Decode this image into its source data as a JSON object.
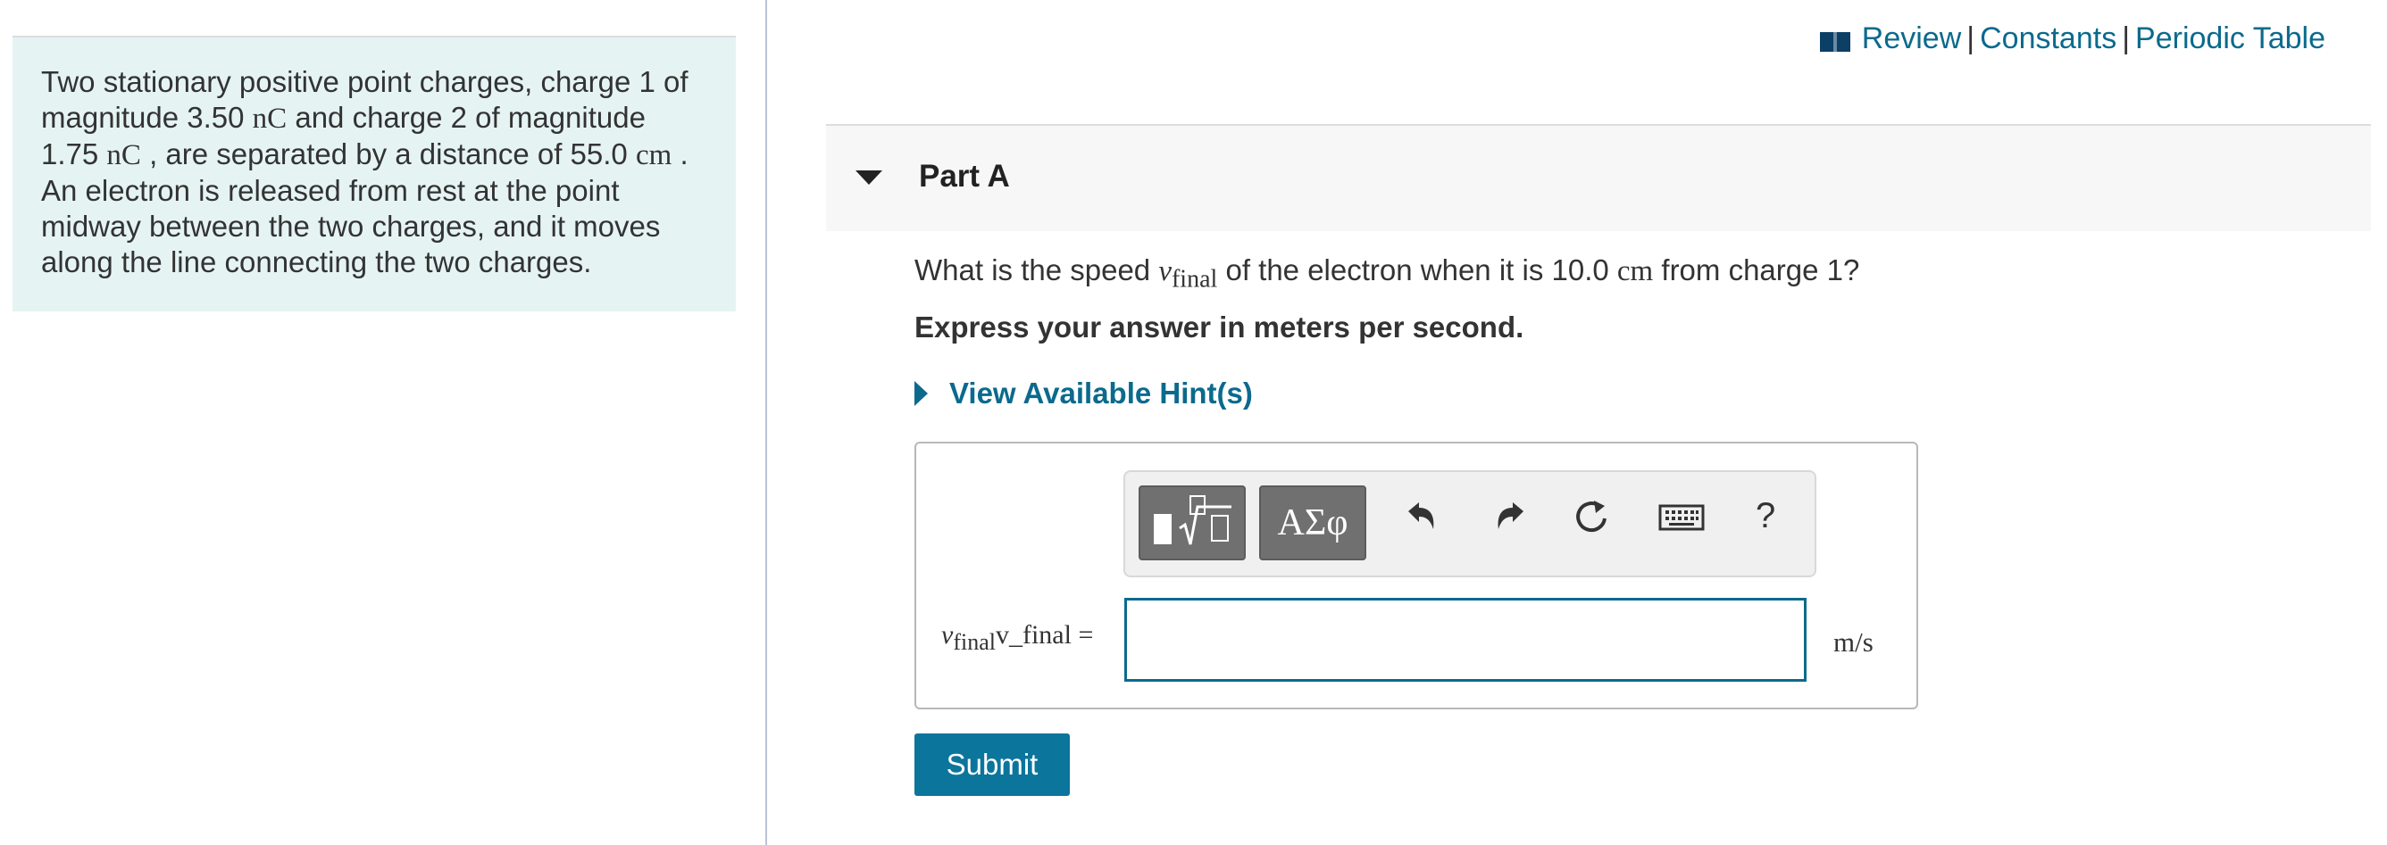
{
  "problem": {
    "line1": "Two stationary positive point charges, charge 1 of",
    "line2_a": "magnitude 3.50 ",
    "line2_unit": "nC",
    "line2_b": " and charge 2 of magnitude",
    "line3_a": "1.75 ",
    "line3_unit": "nC",
    "line3_b": " , are separated by a distance of 55.0 ",
    "line3_unit2": "cm",
    "line3_c": " .",
    "line4": "An electron is released from rest at the point",
    "line5": "midway between the two charges, and it moves",
    "line6": "along the line connecting the two charges."
  },
  "header_links": {
    "review": "Review",
    "separator": "|",
    "constants": "Constants",
    "periodic_table": "Periodic Table"
  },
  "part": {
    "title": "Part A",
    "question_a": "What is the speed ",
    "question_var": "v",
    "question_sub": "final",
    "question_b": " of the electron when it is 10.0 ",
    "question_unit": "cm",
    "question_c": " from charge 1?",
    "instruction": "Express your answer in meters per second.",
    "hint_label": "View Available Hint(s)"
  },
  "answer": {
    "var_symbol": "v",
    "var_sub": "final",
    "var_alt": "v_final =",
    "input_value": "",
    "units": "m/s",
    "toolbar": {
      "templates_icon": "fraction-root-template-icon",
      "greek_label": "ΑΣφ",
      "undo_icon": "undo-icon",
      "redo_icon": "redo-icon",
      "reset_icon": "reset-icon",
      "keyboard_icon": "keyboard-icon",
      "help_label": "?"
    }
  },
  "submit_label": "Submit",
  "colors": {
    "link": "#0b6a8d",
    "submit_bg": "#0b759c",
    "problem_bg": "#e5f4f3"
  }
}
